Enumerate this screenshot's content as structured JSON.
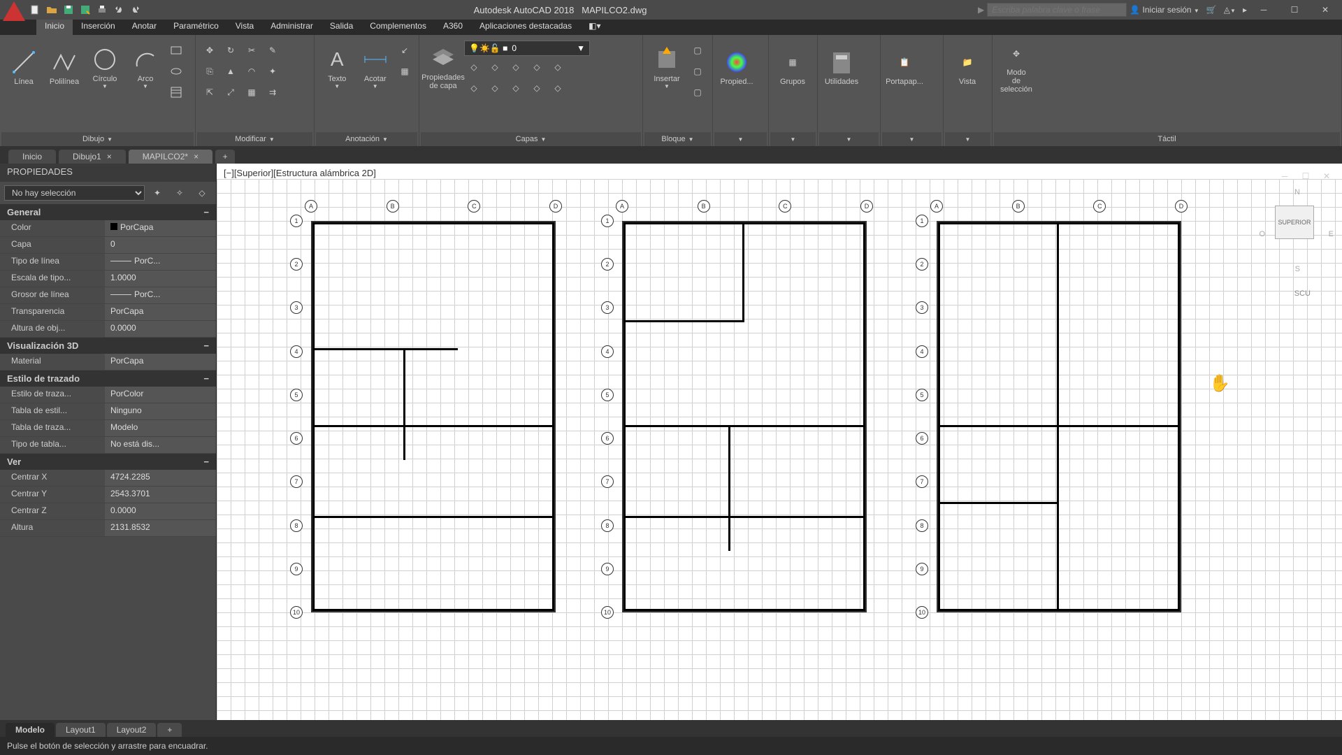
{
  "title": {
    "app": "Autodesk AutoCAD 2018",
    "file": "MAPILCO2.dwg"
  },
  "search": {
    "placeholder": "Escriba palabra clave o frase"
  },
  "user": {
    "login": "Iniciar sesión"
  },
  "ribbon": {
    "tabs": [
      "Inicio",
      "Inserción",
      "Anotar",
      "Paramétrico",
      "Vista",
      "Administrar",
      "Salida",
      "Complementos",
      "A360",
      "Aplicaciones destacadas"
    ],
    "panels": {
      "dibujo": {
        "label": "Dibujo",
        "items": [
          "Línea",
          "Polilínea",
          "Círculo",
          "Arco"
        ]
      },
      "modificar": {
        "label": "Modificar"
      },
      "anotacion": {
        "label": "Anotación",
        "items": [
          "Texto",
          "Acotar"
        ]
      },
      "capas": {
        "label": "Capas",
        "prop": "Propiedades de capa",
        "current": "0"
      },
      "bloque": {
        "label": "Bloque",
        "item": "Insertar"
      },
      "props": {
        "label": "Propied..."
      },
      "grupos": {
        "label": "Grupos"
      },
      "util": {
        "label": "Utilidades"
      },
      "porta": {
        "label": "Portapap..."
      },
      "vista": {
        "label": "Vista"
      },
      "modo": {
        "label1": "Modo",
        "label2": "de selección",
        "panel_lbl": "Táctil"
      }
    }
  },
  "docs": [
    "Inicio",
    "Dibujo1",
    "MAPILCO2*"
  ],
  "props": {
    "title": "PROPIEDADES",
    "select": "No hay selección",
    "sections": [
      {
        "name": "General",
        "rows": [
          {
            "n": "Color",
            "v": "PorCapa"
          },
          {
            "n": "Capa",
            "v": "0"
          },
          {
            "n": "Tipo de línea",
            "v": "PorC..."
          },
          {
            "n": "Escala de tipo...",
            "v": "1.0000"
          },
          {
            "n": "Grosor de línea",
            "v": "PorC..."
          },
          {
            "n": "Transparencia",
            "v": "PorCapa"
          },
          {
            "n": "Altura de obj...",
            "v": "0.0000"
          }
        ]
      },
      {
        "name": "Visualización 3D",
        "rows": [
          {
            "n": "Material",
            "v": "PorCapa"
          }
        ]
      },
      {
        "name": "Estilo de trazado",
        "rows": [
          {
            "n": "Estilo de traza...",
            "v": "PorColor"
          },
          {
            "n": "Tabla de estil...",
            "v": "Ninguno"
          },
          {
            "n": "Tabla de traza...",
            "v": "Modelo"
          },
          {
            "n": "Tipo de tabla...",
            "v": "No está dis..."
          }
        ]
      },
      {
        "name": "Ver",
        "rows": [
          {
            "n": "Centrar X",
            "v": "4724.2285"
          },
          {
            "n": "Centrar Y",
            "v": "2543.3701"
          },
          {
            "n": "Centrar Z",
            "v": "0.0000"
          },
          {
            "n": "Altura",
            "v": "2131.8532"
          }
        ]
      }
    ]
  },
  "viewport": {
    "label": "[−][Superior][Estructura alámbrica 2D]"
  },
  "nav": {
    "compass": {
      "n": "N",
      "e": "E",
      "s": "S",
      "o": "O"
    },
    "cube": "SUPERIOR",
    "scu": "SCU"
  },
  "layouts": [
    "Modelo",
    "Layout1",
    "Layout2"
  ],
  "status": "Pulse el botón de selección y arrastre para encuadrar.",
  "grid_labels": {
    "cols": [
      "A",
      "B",
      "C",
      "D"
    ],
    "rows": [
      "1",
      "2",
      "3",
      "4",
      "5",
      "6",
      "7",
      "8",
      "9",
      "10"
    ]
  }
}
